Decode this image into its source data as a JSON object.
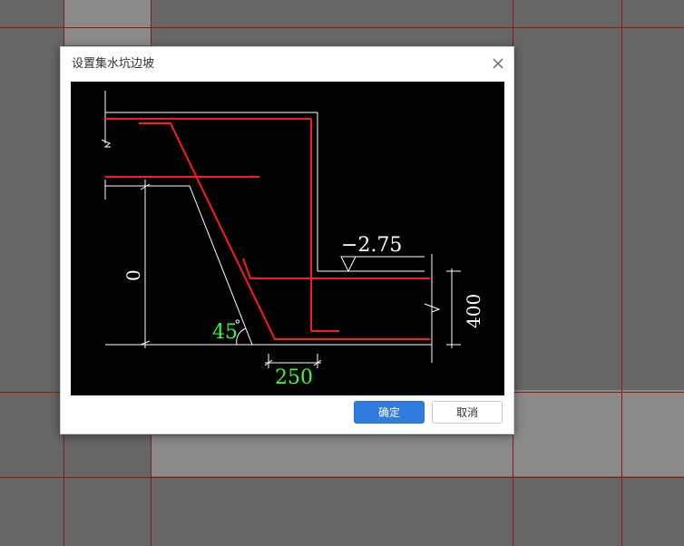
{
  "dialog": {
    "title": "设置集水坑边坡",
    "ok_label": "确定",
    "cancel_label": "取消"
  },
  "diagram": {
    "level_label": "−2.75",
    "depth_label": "0",
    "thickness_label": "400",
    "angle_label": "45",
    "angle_unit": "°",
    "width_label": "250"
  },
  "colors": {
    "background": "#666666",
    "grid_line": "#8b1a1a",
    "rebar": "#ff1a1a",
    "outline": "#ffffff",
    "dim_highlight": "#33ff33",
    "ok_button": "#2f7be0"
  },
  "icons": {
    "close": "close-icon"
  }
}
